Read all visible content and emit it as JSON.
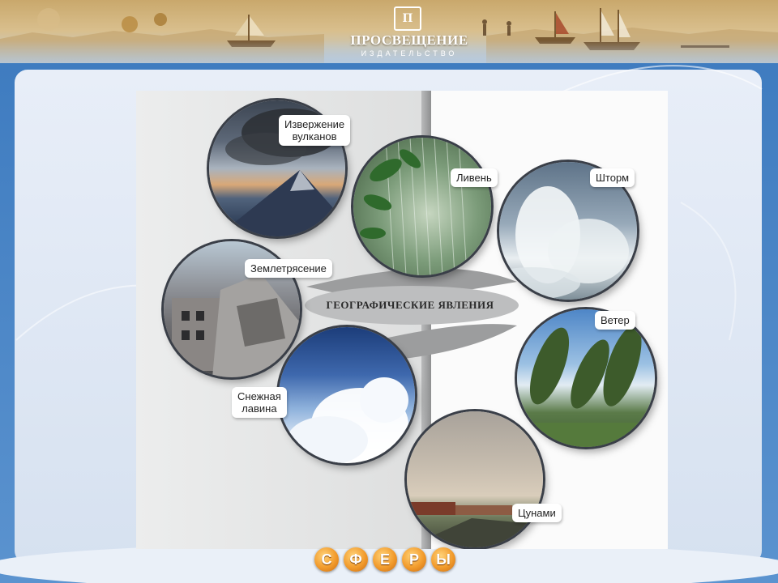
{
  "header": {
    "publisher": "ПРОСВЕЩЕНИЕ",
    "publisher_sub": "ИЗДАТЕЛЬСТВО",
    "logo_mark": "П"
  },
  "diagram": {
    "title": "ГЕОГРАФИЧЕСКИЕ  ЯВЛЕНИЯ",
    "items": [
      {
        "label_line1": "Извержение",
        "label_line2": "вулканов"
      },
      {
        "label": "Ливень"
      },
      {
        "label": "Шторм"
      },
      {
        "label": "Землетрясение"
      },
      {
        "label": "Ветер"
      },
      {
        "label_line1": "Снежная",
        "label_line2": "лавина"
      },
      {
        "label": "Цунами"
      }
    ]
  },
  "nav": {
    "buttons": [
      "С",
      "Ф",
      "Е",
      "Р",
      "Ы"
    ]
  },
  "colors": {
    "frame": "#3f7cc0",
    "panel": "#dfe7f3",
    "nav_orange": "#f29b2c"
  }
}
